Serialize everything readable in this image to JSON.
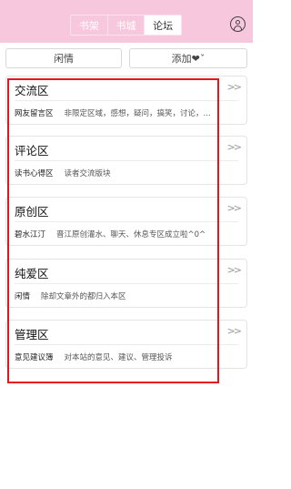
{
  "header": {
    "tabs": [
      {
        "label": "书架"
      },
      {
        "label": "书城"
      },
      {
        "label": "论坛"
      }
    ],
    "active_tab": "论坛"
  },
  "actions": {
    "idle_label": "闲情",
    "add_label": "添加❤︎ˇ"
  },
  "sections": [
    {
      "title": "交流区",
      "sub_name": "网友留言区",
      "sub_desc": "非限定区域，感想，疑问，搞笑，讨论，..."
    },
    {
      "title": "评论区",
      "sub_name": "读书心得区",
      "sub_desc": "读者交流版块"
    },
    {
      "title": "原创区",
      "sub_name": "碧水江汀",
      "sub_desc": "晋江原创灌水、聊天、休息专区成立啦^0^"
    },
    {
      "title": "纯爱区",
      "sub_name": "闲情",
      "sub_desc": "除却文章外的都归入本区"
    },
    {
      "title": "管理区",
      "sub_name": "意见建议簿",
      "sub_desc": "对本站的意见、建议、管理投诉"
    }
  ],
  "icons": {
    "more": "double-chevron-right-icon",
    "user": "user-icon"
  },
  "colors": {
    "header_bg": "#f7c8dd",
    "highlight_frame": "#e8141e"
  }
}
